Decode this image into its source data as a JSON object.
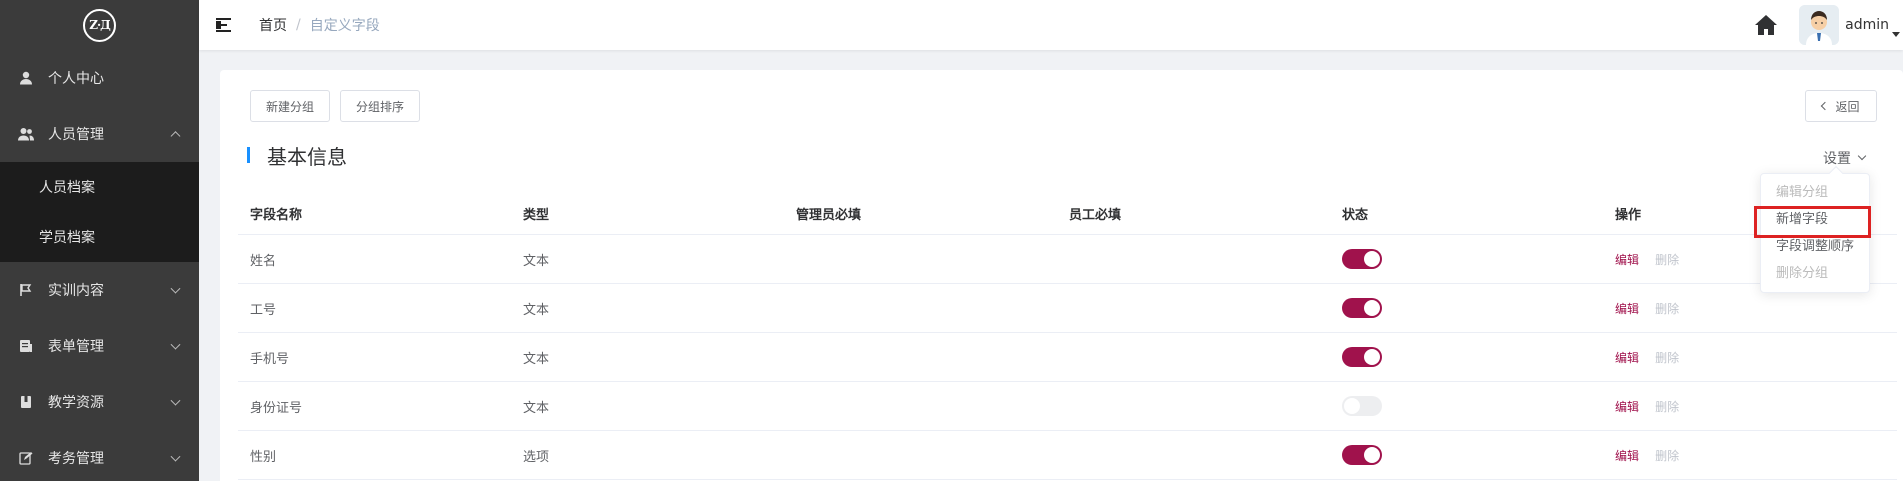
{
  "logo": {
    "text": "Z·Д"
  },
  "sidebar": {
    "items": [
      {
        "label": "个人中心",
        "icon": "user-icon"
      },
      {
        "label": "人员管理",
        "icon": "users-icon",
        "expanded": true
      },
      {
        "label": "实训内容",
        "icon": "flag-icon"
      },
      {
        "label": "表单管理",
        "icon": "form-icon"
      },
      {
        "label": "教学资源",
        "icon": "book-icon"
      },
      {
        "label": "考务管理",
        "icon": "edit-icon"
      }
    ],
    "subitems": [
      {
        "label": "人员档案"
      },
      {
        "label": "学员档案"
      }
    ]
  },
  "header": {
    "breadcrumb_home": "首页",
    "breadcrumb_sep": "/",
    "breadcrumb_current": "自定义字段",
    "username": "admin"
  },
  "toolbar": {
    "new_group": "新建分组",
    "sort_group": "分组排序",
    "back": "返回"
  },
  "section": {
    "title": "基本信息",
    "settings": "设置"
  },
  "table": {
    "headers": [
      "字段名称",
      "类型",
      "管理员必填",
      "员工必填",
      "状态",
      "操作"
    ],
    "rows": [
      {
        "name": "姓名",
        "type": "文本",
        "admin_required": "",
        "staff_required": "",
        "enabled": true,
        "edit": "编辑",
        "delete": "删除"
      },
      {
        "name": "工号",
        "type": "文本",
        "admin_required": "",
        "staff_required": "",
        "enabled": true,
        "edit": "编辑",
        "delete": "删除"
      },
      {
        "name": "手机号",
        "type": "文本",
        "admin_required": "",
        "staff_required": "",
        "enabled": true,
        "edit": "编辑",
        "delete": "删除"
      },
      {
        "name": "身份证号",
        "type": "文本",
        "admin_required": "",
        "staff_required": "",
        "enabled": false,
        "edit": "编辑",
        "delete": "删除"
      },
      {
        "name": "性别",
        "type": "选项",
        "admin_required": "",
        "staff_required": "",
        "enabled": true,
        "edit": "编辑",
        "delete": "删除"
      }
    ]
  },
  "dropdown": {
    "items": [
      {
        "label": "编辑分组",
        "disabled": true
      },
      {
        "label": "新增字段",
        "disabled": false,
        "highlighted": true
      },
      {
        "label": "字段调整顺序",
        "disabled": false
      },
      {
        "label": "删除分组",
        "disabled": true
      }
    ]
  },
  "colors": {
    "sidebar_bg": "#3b3b3b",
    "submenu_bg": "#1c1c1c",
    "accent": "#a0124c",
    "section_bar": "#1890ff",
    "highlight_border": "#dd2222"
  }
}
